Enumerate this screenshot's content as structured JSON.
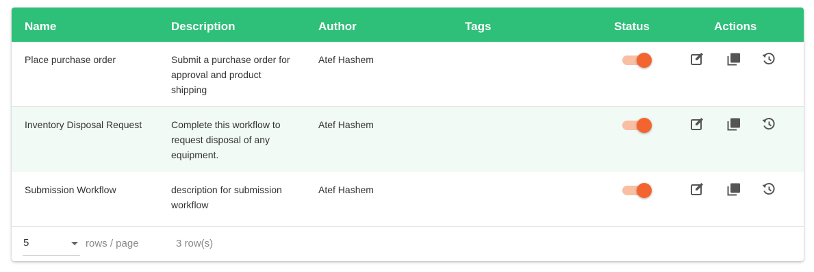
{
  "table": {
    "columns": {
      "name": "Name",
      "description": "Description",
      "author": "Author",
      "tags": "Tags",
      "status": "Status",
      "actions": "Actions"
    },
    "rows": [
      {
        "name": "Place purchase order",
        "description": [
          "Submit a purchase order for",
          "approval and product",
          "shipping"
        ],
        "author": "Atef Hashem",
        "tags": "",
        "status_on": true
      },
      {
        "name": "Inventory Disposal Request",
        "description": [
          "Complete this workflow to",
          "request disposal of any",
          "equipment."
        ],
        "author": "Atef Hashem",
        "tags": "",
        "status_on": true
      },
      {
        "name": "Submission Workflow",
        "description": [
          "description for submission",
          "workflow"
        ],
        "author": "Atef Hashem",
        "tags": "",
        "status_on": true
      }
    ],
    "actions": [
      "edit-icon",
      "copy-icon",
      "history-icon"
    ]
  },
  "pagination": {
    "rows_per_page_value": "5",
    "rows_per_page_label": "rows / page",
    "row_count": "3 row(s)"
  },
  "colors": {
    "header": "#2ebf79",
    "toggle_thumb": "#f4642f",
    "toggle_track": "#f8bfa4",
    "alt_row": "#f1faf5",
    "icon": "#555555"
  }
}
